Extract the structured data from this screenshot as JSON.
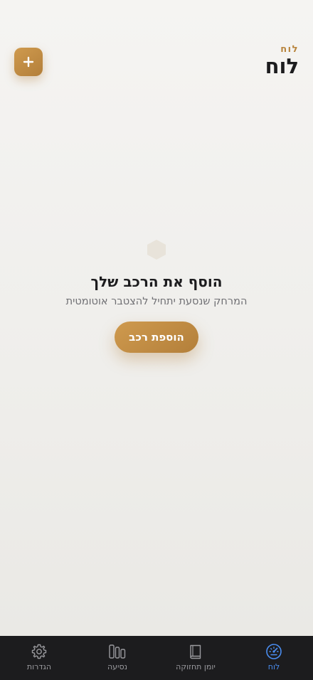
{
  "header": {
    "eyebrow": "לוח",
    "title": "לוח"
  },
  "empty_state": {
    "title": "הוסף את הרכב שלך",
    "subtitle": "המרחק שנסעת יתחיל להצטבר אוטומטית",
    "button_label": "הוספת רכב"
  },
  "tabs": [
    {
      "label": "לוח",
      "icon": "speedometer-icon",
      "active": true
    },
    {
      "label": "יומן תחזוקה",
      "icon": "book-icon",
      "active": false
    },
    {
      "label": "נסיעה",
      "icon": "bars-icon",
      "active": false
    },
    {
      "label": "הגדרות",
      "icon": "gear-icon",
      "active": false
    }
  ],
  "colors": {
    "accent": "#c08a45",
    "active_tab": "#4a8df0",
    "inactive_tab": "#9a9a9e",
    "tabbar_bg": "#1c1c1e"
  }
}
